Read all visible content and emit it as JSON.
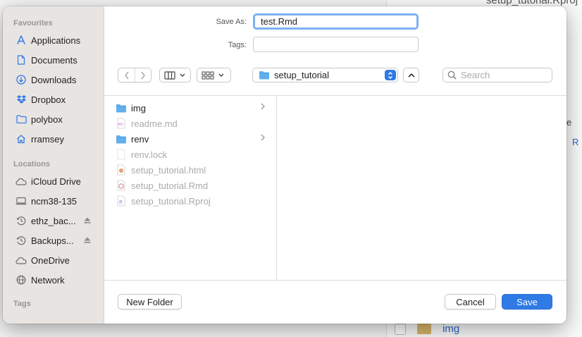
{
  "colors": {
    "accent": "#2f7ae5",
    "focus_ring": "#7fb0f0",
    "folder": "#62b0ee"
  },
  "background": {
    "top_text": "setup_tutorial.Rproj",
    "column_header": "e",
    "r_label": "R",
    "bottom_item": "img"
  },
  "sidebar": {
    "favourites_title": "Favourites",
    "favourites": [
      {
        "label": "Applications",
        "icon": "applications-icon"
      },
      {
        "label": "Documents",
        "icon": "document-icon"
      },
      {
        "label": "Downloads",
        "icon": "download-icon"
      },
      {
        "label": "Dropbox",
        "icon": "dropbox-icon"
      },
      {
        "label": "polybox",
        "icon": "folder-icon"
      },
      {
        "label": "rramsey",
        "icon": "home-icon"
      }
    ],
    "locations_title": "Locations",
    "locations": [
      {
        "label": "iCloud Drive",
        "icon": "cloud-icon"
      },
      {
        "label": "ncm38-135",
        "icon": "computer-icon"
      },
      {
        "label": "ethz_bac...",
        "icon": "time-machine-icon",
        "eject": true
      },
      {
        "label": "Backups...",
        "icon": "time-machine-icon",
        "eject": true
      },
      {
        "label": "OneDrive",
        "icon": "cloud-icon"
      },
      {
        "label": "Network",
        "icon": "globe-icon"
      }
    ],
    "tags_title": "Tags"
  },
  "form": {
    "save_as_label": "Save As:",
    "save_as_value": "test.Rmd",
    "tags_label": "Tags:",
    "tags_value": ""
  },
  "toolbar": {
    "current_folder": "setup_tutorial",
    "search_placeholder": "Search"
  },
  "files": [
    {
      "name": "img",
      "kind": "folder",
      "enabled": true,
      "has_children": true
    },
    {
      "name": "readme.md",
      "kind": "md",
      "enabled": false,
      "has_children": false
    },
    {
      "name": "renv",
      "kind": "folder",
      "enabled": true,
      "has_children": true
    },
    {
      "name": "renv.lock",
      "kind": "blank",
      "enabled": false,
      "has_children": false
    },
    {
      "name": "setup_tutorial.html",
      "kind": "html",
      "enabled": false,
      "has_children": false
    },
    {
      "name": "setup_tutorial.Rmd",
      "kind": "rmd",
      "enabled": false,
      "has_children": false
    },
    {
      "name": "setup_tutorial.Rproj",
      "kind": "rproj",
      "enabled": false,
      "has_children": false
    }
  ],
  "footer": {
    "new_folder_label": "New Folder",
    "cancel_label": "Cancel",
    "save_label": "Save"
  }
}
